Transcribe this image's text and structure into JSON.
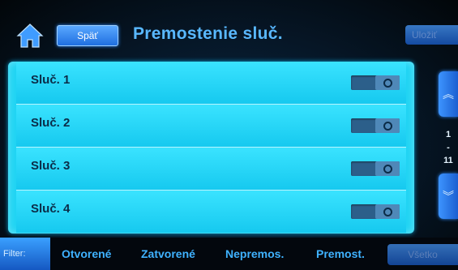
{
  "header": {
    "home_icon": "home-icon",
    "back_label": "Späť",
    "title": "Premostenie sluč.",
    "save_label": "Uložiť"
  },
  "loops": [
    {
      "label": "Sluč. 1",
      "bypassed": false
    },
    {
      "label": "Sluč. 2",
      "bypassed": false
    },
    {
      "label": "Sluč. 3",
      "bypassed": false
    },
    {
      "label": "Sluč. 4",
      "bypassed": false
    }
  ],
  "pager": {
    "up_icon": "double-chevron-up-icon",
    "down_icon": "double-chevron-down-icon",
    "current": "1",
    "separator": "-",
    "total": "11"
  },
  "filter": {
    "label": "Filter:",
    "items": [
      "Otvorené",
      "Zatvorené",
      "Nepremos.",
      "Premost."
    ],
    "all_label": "Všetko"
  },
  "colors": {
    "accent": "#1f6fe0",
    "list_bg": "#1fd4f3",
    "title": "#59b8ff",
    "row_text": "#0b2c48"
  }
}
